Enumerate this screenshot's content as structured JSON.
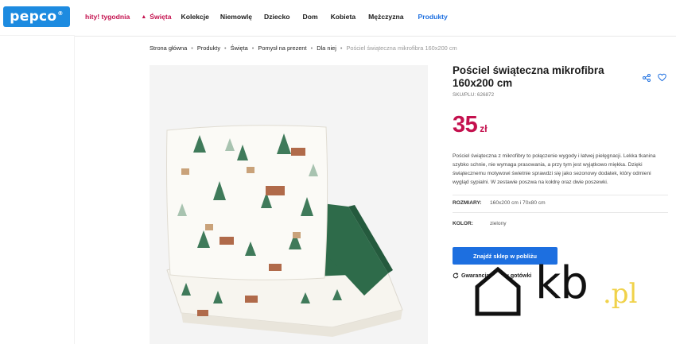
{
  "brand": {
    "logo_text": "pepco",
    "logo_mark": "®",
    "color": "#1d8be0"
  },
  "nav": {
    "items": [
      {
        "label": "hity! tygodnia",
        "style": "hity"
      },
      {
        "label": "Święta",
        "style": "swieta",
        "icon": "tree-icon"
      },
      {
        "label": "Kolekcje",
        "style": ""
      },
      {
        "label": "Niemowlę",
        "style": ""
      },
      {
        "label": "Dziecko",
        "style": ""
      },
      {
        "label": "Dom",
        "style": ""
      },
      {
        "label": "Kobieta",
        "style": ""
      },
      {
        "label": "Mężczyzna",
        "style": ""
      },
      {
        "label": "Produkty",
        "style": "produkty"
      }
    ]
  },
  "breadcrumb": {
    "items": [
      "Strona główna",
      "Produkty",
      "Święta",
      "Pomysł na prezent",
      "Dla niej"
    ],
    "current": "Pościel świąteczna mikrofibra 160x200 cm"
  },
  "product": {
    "title": "Pościel świąteczna mikrofibra 160x200 cm",
    "sku": "SKU/PLU: 626872",
    "price": "35",
    "currency": "zł",
    "price_color": "#c4114e",
    "description": "Pościel świąteczna z mikrofibry to połączenie wygody i łatwej pielęgnacji. Lekka tkanina szybko schnie, nie wymaga prasowania, a przy tym jest wyjątkowo miękka. Dzięki świątecznemu motywowi świetnie sprawdzi się jako sezonowy dodatek, który odmieni wygląd sypialni. W zestawie poszwa na kołdrę oraz dwie poszewki.",
    "attributes": [
      {
        "label": "ROZMIARY:",
        "value": "160x200 cm i 70x80 cm"
      },
      {
        "label": "KOLOR:",
        "value": "zielony"
      }
    ],
    "cta_label": "Znajdź sklep w pobliżu",
    "guarantee_label": "Gwarancja zwrotu gotówki",
    "accent": "#1d6fe0",
    "green_fabric": "#2e6b4a"
  },
  "watermark": {
    "text": "kb",
    "suffix": ".pl"
  }
}
